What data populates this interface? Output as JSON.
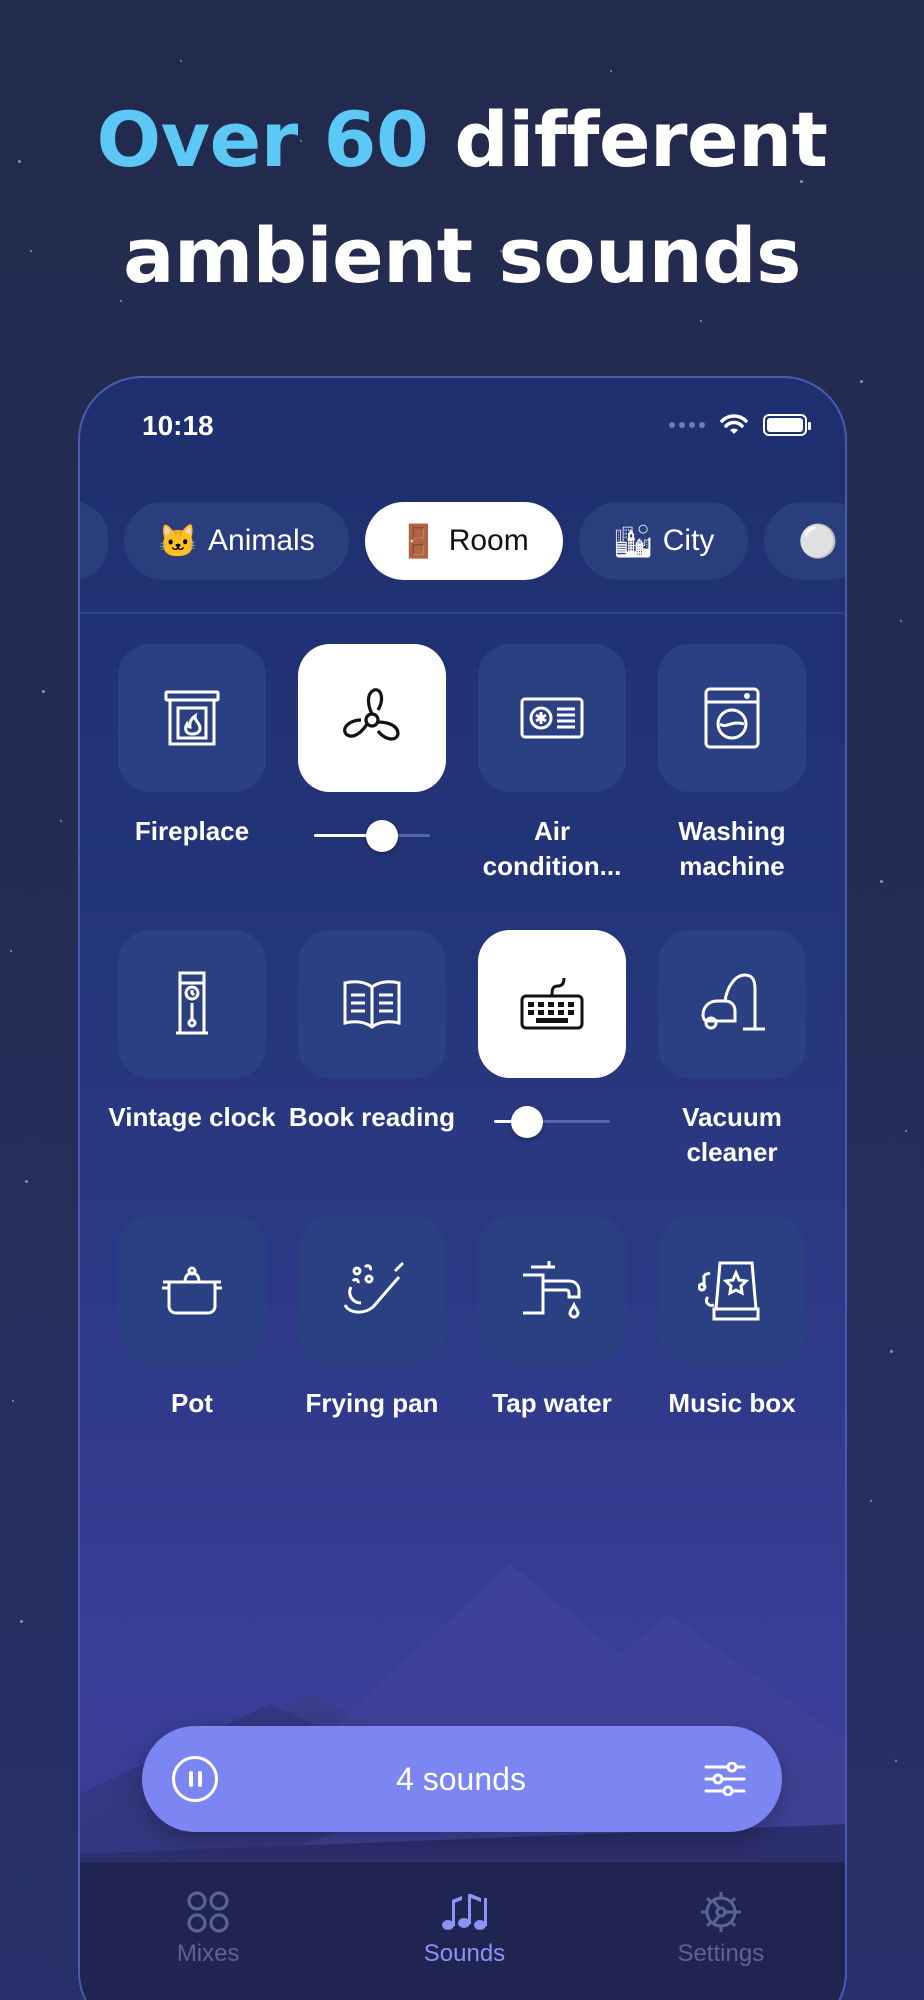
{
  "headline": {
    "accent": "Over 60",
    "line1_rest": " different",
    "line2": "ambient sounds"
  },
  "status": {
    "time": "10:18"
  },
  "categories": [
    {
      "emoji": "🐱",
      "label": "Animals",
      "active": false
    },
    {
      "emoji": "🚪",
      "label": "Room",
      "active": true
    },
    {
      "emoji": "🏙",
      "label": "City",
      "active": false
    },
    {
      "emoji": "⚪",
      "label": "",
      "active": false
    }
  ],
  "sounds": [
    {
      "label": "Fireplace",
      "icon": "fireplace-icon",
      "active": false
    },
    {
      "label": "",
      "icon": "fan-icon",
      "active": true,
      "volume": 0.62
    },
    {
      "label": "Air condition...",
      "icon": "air-conditioner-icon",
      "active": false
    },
    {
      "label": "Washing machine",
      "icon": "washing-machine-icon",
      "active": false
    },
    {
      "label": "Vintage clock",
      "icon": "clock-icon",
      "active": false
    },
    {
      "label": "Book reading",
      "icon": "book-icon",
      "active": false
    },
    {
      "label": "",
      "icon": "keyboard-icon",
      "active": true,
      "volume": 0.2
    },
    {
      "label": "Vacuum cleaner",
      "icon": "vacuum-icon",
      "active": false
    },
    {
      "label": "Pot",
      "icon": "pot-icon",
      "active": false
    },
    {
      "label": "Frying pan",
      "icon": "frying-pan-icon",
      "active": false
    },
    {
      "label": "Tap water",
      "icon": "tap-icon",
      "active": false
    },
    {
      "label": "Music box",
      "icon": "music-box-icon",
      "active": false
    }
  ],
  "player": {
    "title": "4 sounds"
  },
  "tabbar": [
    {
      "label": "Mixes",
      "icon": "mixes-icon",
      "active": false
    },
    {
      "label": "Sounds",
      "icon": "music-notes-icon",
      "active": true
    },
    {
      "label": "Settings",
      "icon": "gear-icon",
      "active": false
    }
  ],
  "colors": {
    "accent": "#5cc8f6",
    "player": "#7b86f3",
    "tab_active": "#8b93f6"
  }
}
